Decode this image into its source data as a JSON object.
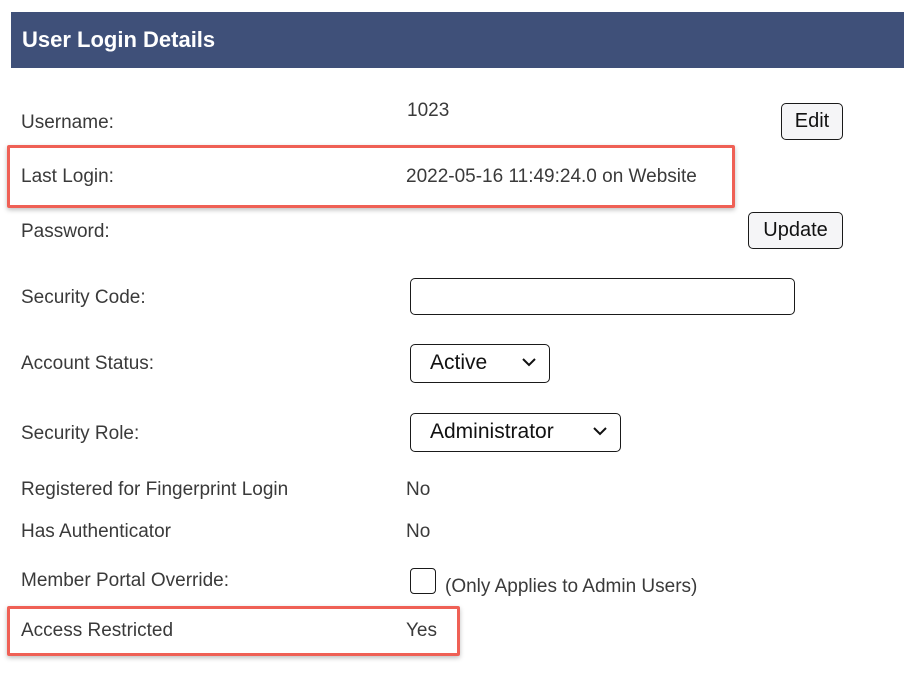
{
  "panel": {
    "title": "User Login Details"
  },
  "rows": {
    "username": {
      "label": "Username:",
      "value": "1023",
      "button": "Edit"
    },
    "last_login": {
      "label": "Last Login:",
      "value": "2022-05-16 11:49:24.0 on Website"
    },
    "password": {
      "label": "Password:",
      "button": "Update"
    },
    "security_code": {
      "label": "Security Code:",
      "value": ""
    },
    "account_status": {
      "label": "Account Status:",
      "selected": "Active"
    },
    "security_role": {
      "label": "Security Role:",
      "selected": "Administrator"
    },
    "fingerprint": {
      "label": "Registered for Fingerprint Login",
      "value": "No"
    },
    "authenticator": {
      "label": "Has Authenticator",
      "value": "No"
    },
    "member_portal_override": {
      "label": "Member Portal Override:",
      "checked": false,
      "note": "(Only Applies to Admin Users)"
    },
    "access_restricted": {
      "label": "Access Restricted",
      "value": "Yes"
    }
  },
  "colors": {
    "header_bg": "#3f5079",
    "highlight": "#ef6055"
  }
}
